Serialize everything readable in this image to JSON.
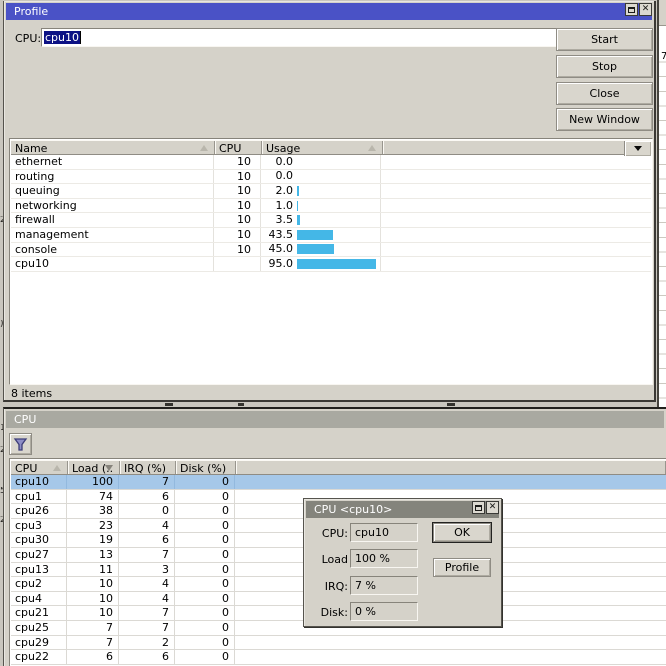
{
  "colors": {
    "title_active": "#4a52c6",
    "usage_bar": "#44b7e7",
    "selected_row": "#a6c8e9"
  },
  "profile_window": {
    "title": "Profile",
    "toolbar": {
      "cpu_label": "CPU:",
      "cpu_value": "cpu10"
    },
    "action_buttons": {
      "start": "Start",
      "stop": "Stop",
      "close": "Close",
      "new_window": "New Window"
    },
    "table": {
      "columns": {
        "name": "Name",
        "cpu": "CPU",
        "usage": "Usage"
      },
      "rows": [
        {
          "name": "ethernet",
          "cpu": "10",
          "usage": "0.0"
        },
        {
          "name": "routing",
          "cpu": "10",
          "usage": "0.0"
        },
        {
          "name": "queuing",
          "cpu": "10",
          "usage": "2.0"
        },
        {
          "name": "networking",
          "cpu": "10",
          "usage": "1.0"
        },
        {
          "name": "firewall",
          "cpu": "10",
          "usage": "3.5"
        },
        {
          "name": "management",
          "cpu": "10",
          "usage": "43.5"
        },
        {
          "name": "console",
          "cpu": "10",
          "usage": "45.0"
        },
        {
          "name": "cpu10",
          "cpu": "",
          "usage": "95.0"
        }
      ]
    },
    "status_bar": "8 items"
  },
  "cpu_window": {
    "title": "CPU",
    "table": {
      "columns": {
        "cpu": "CPU",
        "load": "Load (..",
        "irq": "IRQ (%)",
        "disk": "Disk (%)"
      },
      "rows": [
        {
          "cpu": "cpu10",
          "load": "100",
          "irq": "7",
          "disk": "0"
        },
        {
          "cpu": "cpu1",
          "load": "74",
          "irq": "6",
          "disk": "0"
        },
        {
          "cpu": "cpu26",
          "load": "38",
          "irq": "0",
          "disk": "0"
        },
        {
          "cpu": "cpu3",
          "load": "23",
          "irq": "4",
          "disk": "0"
        },
        {
          "cpu": "cpu30",
          "load": "19",
          "irq": "6",
          "disk": "0"
        },
        {
          "cpu": "cpu27",
          "load": "13",
          "irq": "7",
          "disk": "0"
        },
        {
          "cpu": "cpu13",
          "load": "11",
          "irq": "3",
          "disk": "0"
        },
        {
          "cpu": "cpu2",
          "load": "10",
          "irq": "4",
          "disk": "0"
        },
        {
          "cpu": "cpu4",
          "load": "10",
          "irq": "4",
          "disk": "0"
        },
        {
          "cpu": "cpu21",
          "load": "10",
          "irq": "7",
          "disk": "0"
        },
        {
          "cpu": "cpu25",
          "load": "7",
          "irq": "7",
          "disk": "0"
        },
        {
          "cpu": "cpu29",
          "load": "7",
          "irq": "2",
          "disk": "0"
        },
        {
          "cpu": "cpu22",
          "load": "6",
          "irq": "6",
          "disk": "0"
        }
      ]
    }
  },
  "cpu_dialog": {
    "title": "CPU <cpu10>",
    "fields": [
      {
        "label": "CPU:",
        "value": "cpu10"
      },
      {
        "label": "Load",
        "value": "100 %"
      },
      {
        "label": "IRQ:",
        "value": "7 %"
      },
      {
        "label": "Disk:",
        "value": "0 %"
      }
    ],
    "buttons": {
      "ok": "OK",
      "profile": "Profile"
    }
  },
  "background": {
    "right_sliver_value": "7"
  }
}
